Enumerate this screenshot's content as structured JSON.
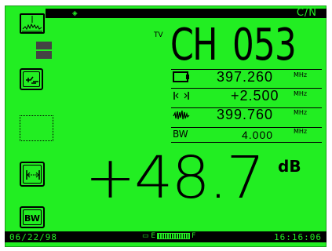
{
  "header": {
    "mode_title": "C/N",
    "diamond_icon": "diamond-marker-icon"
  },
  "sidebar": {
    "spectrum_icon": "spectrum-trace-icon",
    "attenuator_icon": "attenuator-icon",
    "span_icon": "span-arrows-icon",
    "bw_label": "BW"
  },
  "channel": {
    "tv_tag": "TV",
    "ch_label": "CH",
    "ch_number": "053"
  },
  "readouts": {
    "video_freq": {
      "icon": "carrier-icon",
      "value": "397.260",
      "unit": "MHz"
    },
    "offset": {
      "icon": "offset-arrows-icon",
      "value": "+2.500",
      "unit": "MHz"
    },
    "noise_freq": {
      "icon": "noise-icon",
      "value": "399.760",
      "unit": "MHz"
    },
    "bandwidth": {
      "label": "BW",
      "value": "4.000",
      "unit": "MHz"
    }
  },
  "measurement": {
    "value": "+48.7",
    "unit": "dB"
  },
  "statusbar": {
    "date": "06/22/98",
    "battery_e": "E",
    "battery_f": "F",
    "battery_level": 0.95,
    "time": "16:16:06"
  },
  "colors": {
    "screen_bg": "#22ee22",
    "ink": "#000000"
  }
}
